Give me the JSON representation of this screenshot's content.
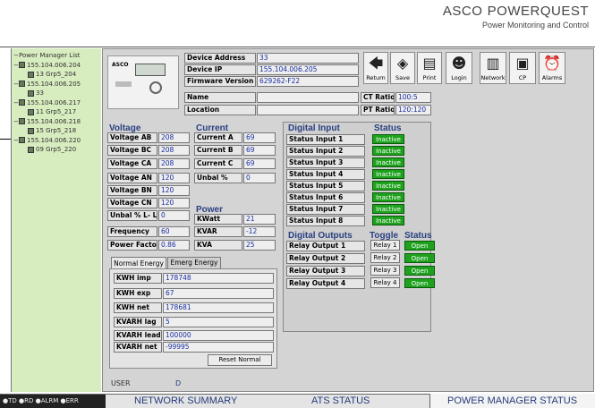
{
  "brand": {
    "name": "ASCO",
    "product": "POWERQUEST",
    "tagline": "Power Monitoring and Control"
  },
  "tree": {
    "root": "Power Manager List",
    "items": [
      {
        "ip": "155.104.006.204",
        "child": "13 Grp5_204"
      },
      {
        "ip": "155.104.006.205",
        "child": "33"
      },
      {
        "ip": "155.104.006.217",
        "child": "11 Grp5_217"
      },
      {
        "ip": "155.104.006.218",
        "child": "15 Grp5_218"
      },
      {
        "ip": "155.104.006.220",
        "child": "09 Grp5_220"
      }
    ]
  },
  "device": {
    "logo": "ASCO",
    "labels": {
      "address": "Device Address",
      "ip": "Device IP",
      "firmware": "Firmware Version",
      "name": "Name",
      "location": "Location",
      "ct": "CT Ratio",
      "pt": "PT Ratio"
    },
    "address": "33",
    "ip": "155.104.006.205",
    "firmware": "629262-F22",
    "name": "",
    "location": "",
    "ct": "100:5",
    "pt": "120:120"
  },
  "toolbar": {
    "return": "Return",
    "save": "Save",
    "print": "Print",
    "login": "Login",
    "network": "Network",
    "cp": "CP",
    "alarms": "Alarms"
  },
  "voltage": {
    "title": "Voltage",
    "rows": [
      {
        "label": "Voltage AB",
        "value": "208"
      },
      {
        "label": "Voltage BC",
        "value": "208"
      },
      {
        "label": "Voltage CA",
        "value": "208"
      },
      {
        "label": "Voltage AN",
        "value": "120"
      },
      {
        "label": "Voltage BN",
        "value": "120"
      },
      {
        "label": "Voltage CN",
        "value": "120"
      },
      {
        "label": "Unbal % L- L",
        "value": "0"
      }
    ]
  },
  "current": {
    "title": "Current",
    "rows": [
      {
        "label": "Current A",
        "value": "69"
      },
      {
        "label": "Current B",
        "value": "69"
      },
      {
        "label": "Current C",
        "value": "69"
      },
      {
        "label": "Unbal %",
        "value": "0"
      }
    ]
  },
  "power": {
    "title": "Power",
    "rows": [
      {
        "label": "KWatt",
        "value": "21"
      },
      {
        "label": "KVAR",
        "value": "-12"
      },
      {
        "label": "KVA",
        "value": "25"
      }
    ]
  },
  "misc": {
    "freq_label": "Frequency",
    "freq": "60",
    "pf_label": "Power Factor",
    "pf": "0.86"
  },
  "energy": {
    "tabs": [
      "Normal Energy",
      "Emerg Energy"
    ],
    "rows": [
      {
        "label": "KWH imp",
        "value": "178748"
      },
      {
        "label": "KWH exp",
        "value": "67"
      },
      {
        "label": "KWH net",
        "value": "178681"
      },
      {
        "label": "KVARH lag",
        "value": "5"
      },
      {
        "label": "KVARH lead",
        "value": "100000"
      },
      {
        "label": "KVARH net",
        "value": "-99995"
      }
    ],
    "reset": "Reset Normal"
  },
  "digital_input": {
    "title": "Digital Input",
    "status_title": "Status",
    "rows": [
      {
        "label": "Status Input 1",
        "status": "Inactive"
      },
      {
        "label": "Status Input 2",
        "status": "Inactive"
      },
      {
        "label": "Status Input 3",
        "status": "Inactive"
      },
      {
        "label": "Status Input 4",
        "status": "Inactive"
      },
      {
        "label": "Status Input 5",
        "status": "Inactive"
      },
      {
        "label": "Status Input 6",
        "status": "Inactive"
      },
      {
        "label": "Status Input 7",
        "status": "Inactive"
      },
      {
        "label": "Status Input 8",
        "status": "Inactive"
      }
    ]
  },
  "digital_output": {
    "title": "Digital Outputs",
    "toggle_title": "Toggle",
    "status_title": "Status",
    "rows": [
      {
        "label": "Relay Output 1",
        "button": "Relay 1",
        "status": "Open"
      },
      {
        "label": "Relay Output 2",
        "button": "Relay 2",
        "status": "Open"
      },
      {
        "label": "Relay Output 3",
        "button": "Relay 3",
        "status": "Open"
      },
      {
        "label": "Relay Output 4",
        "button": "Relay 4",
        "status": "Open"
      }
    ]
  },
  "user": {
    "label": "USER",
    "value": "D"
  },
  "statusbar": {
    "indicators": "●TD ●RD ●ALRM ●ERR",
    "network": "NETWORK SUMMARY",
    "ats": "ATS STATUS",
    "pm": "POWER MANAGER STATUS"
  },
  "colors": {
    "green": "#1ea21e",
    "tree_bg": "#d7ecbf",
    "label_blue": "#2a4082"
  }
}
